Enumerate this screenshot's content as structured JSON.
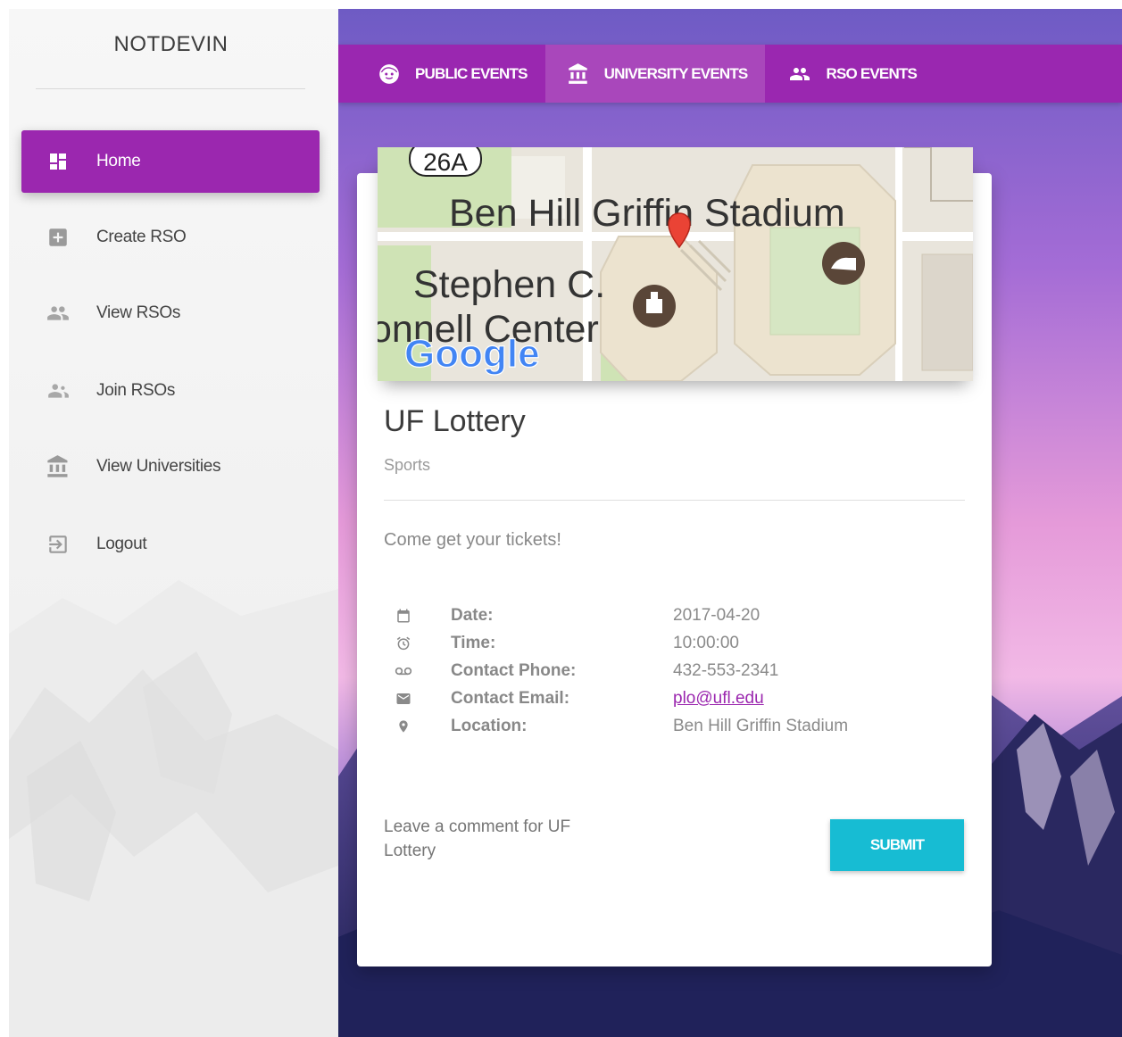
{
  "sidebar": {
    "brand": "NOTDEVIN",
    "items": [
      {
        "label": "Home",
        "icon": "dashboard-icon",
        "active": true
      },
      {
        "label": "Create RSO",
        "icon": "add-box-icon"
      },
      {
        "label": "View RSOs",
        "icon": "people-icon"
      },
      {
        "label": "Join RSOs",
        "icon": "group-add-icon"
      },
      {
        "label": "View Universities",
        "icon": "bank-icon"
      },
      {
        "label": "Logout",
        "icon": "exit-icon"
      }
    ]
  },
  "tabs": [
    {
      "label": "PUBLIC EVENTS",
      "icon": "face-icon"
    },
    {
      "label": "UNIVERSITY EVENTS",
      "icon": "bank-icon",
      "active": true
    },
    {
      "label": "RSO EVENTS",
      "icon": "people-icon"
    }
  ],
  "map": {
    "route_shield": "26A",
    "label_stadium": "Ben Hill Griffin Stadium",
    "label_center_line1": "Stephen C.",
    "label_center_line2": "onnell Center",
    "logo": "Google"
  },
  "event": {
    "title": "UF Lottery",
    "category": "Sports",
    "description": "Come get your tickets!",
    "details": [
      {
        "label": "Date:",
        "value": "2017-04-20",
        "icon": "calendar-icon"
      },
      {
        "label": "Time:",
        "value": "10:00:00",
        "icon": "alarm-icon"
      },
      {
        "label": "Contact Phone:",
        "value": "432-553-2341",
        "icon": "voicemail-icon"
      },
      {
        "label": "Contact Email:",
        "value": "plo@ufl.edu",
        "icon": "mail-icon"
      },
      {
        "label": "Location:",
        "value": "Ben Hill Griffin Stadium",
        "icon": "location-pin-icon"
      }
    ]
  },
  "comment": {
    "placeholder": "Leave a comment for UF Lottery",
    "submit_label": "SUBMIT"
  },
  "colors": {
    "accent": "#9b27af",
    "submit": "#17bcd3"
  }
}
